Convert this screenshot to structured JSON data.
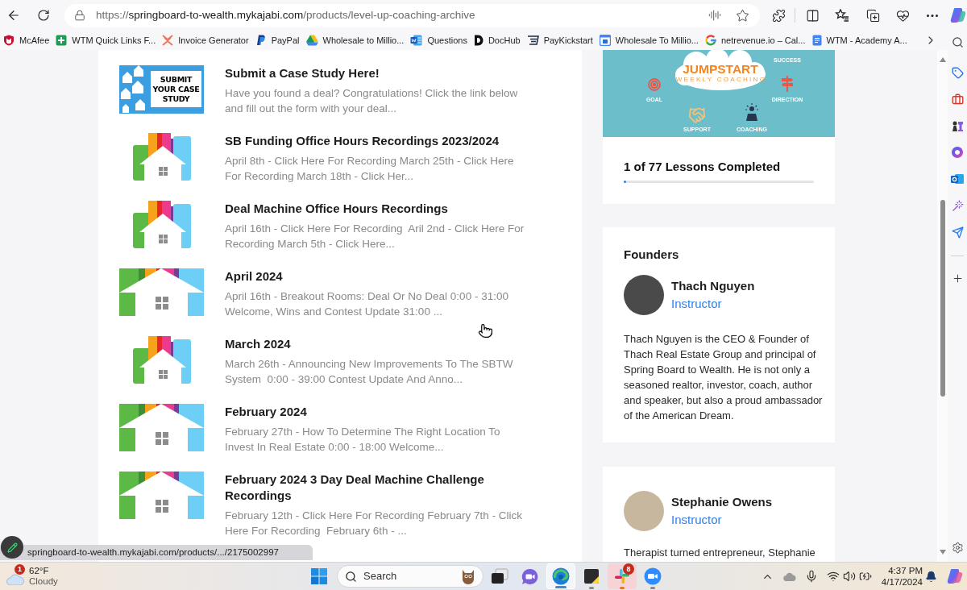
{
  "browser": {
    "url": {
      "scheme": "https://",
      "host": "springboard-to-wealth.mykajabi.com",
      "path": "/products/level-up-coaching-archive"
    }
  },
  "bookmarks": [
    {
      "label": "McAfee",
      "kind": "shield"
    },
    {
      "label": "WTM Quick Links F...",
      "kind": "sheet"
    },
    {
      "label": "Invoice Generator",
      "kind": "chevrons"
    },
    {
      "label": "PayPal",
      "kind": "pmark"
    },
    {
      "label": "Wholesale to Millio...",
      "kind": "triangle"
    },
    {
      "label": "Questions",
      "kind": "word"
    },
    {
      "label": "DocHub",
      "kind": "dmark"
    },
    {
      "label": "PayKickstart",
      "kind": "receipt"
    },
    {
      "label": "Wholesale To Millio...",
      "kind": "calendar"
    },
    {
      "label": "netrevenue.io – Cal...",
      "kind": "gmark"
    },
    {
      "label": "WTM - Academy A...",
      "kind": "doc"
    }
  ],
  "lessons": [
    {
      "kind": "case",
      "thumbnail_text": "SUBMIT YOUR CASE STUDY",
      "title": "Submit a Case Study Here!",
      "description": "Have you found a deal? Congratulations! Click the link below and fill out the form with your deal..."
    },
    {
      "kind": "square",
      "title": "SB Funding Office Hours Recordings 2023/2024",
      "description": "April 8th - Click Here For Recording March 25th - Click Here For Recording March 18th - Click Her..."
    },
    {
      "kind": "square",
      "title": "Deal Machine Office Hours Recordings",
      "description": "April 16th - Click Here For Recording  Aril 2nd - Click Here For Recording March 5th - Click Here..."
    },
    {
      "kind": "wide",
      "title": "April 2024",
      "description": "April 16th - Breakout Rooms: Deal Or No Deal 0:00 - 31:00 Welcome, Wins and Contest Update 31:00 ..."
    },
    {
      "kind": "square",
      "title": "March 2024",
      "description": "March 26th - Announcing New Improvements To The SBTW System  0:00 - 39:00 Contest Update And Anno..."
    },
    {
      "kind": "wide",
      "title": "February 2024",
      "description": "February 27th - How To Determine The Right Location To Invest In Real Estate 0:00 - 18:00 Welcome..."
    },
    {
      "kind": "wide",
      "title": "February 2024 3 Day Deal Machine Challenge Recordings",
      "description": "February 12th - Click Here For Recording February 7th - Click Here For Recording  February 6th - ..."
    }
  ],
  "banner": {
    "title": "JUMPSTART",
    "subtitle": "WEEKLY COACHING",
    "labels": [
      "SUCCESS",
      "GOAL",
      "DIRECTION",
      "SUPPORT",
      "COACHING"
    ]
  },
  "progress": {
    "label": "1 of 77 Lessons Completed",
    "level": 0.013
  },
  "instructor_cards": [
    {
      "heading": "Founders",
      "name": "Thach Nguyen",
      "role": "Instructor",
      "bio": "Thach Nguyen is the CEO & Founder of Thach Real Estate Group and principal of Spring Board to Wealth. He is not only a seasoned realtor, investor, coach, author and speaker, but also a proud ambassador of the American Dream."
    },
    {
      "name": "Stephanie Owens",
      "role": "Instructor",
      "bio": "Therapist turned entrepreneur, Stephanie"
    }
  ],
  "status_url": "springboard-to-wealth.mykajabi.com/products/.../2175002997",
  "taskbar": {
    "weather": {
      "badge": "1",
      "temperature": "62°F",
      "condition": "Cloudy"
    },
    "search": {
      "placeholder": "Search"
    },
    "apps": [
      {
        "kind": "taskview",
        "selected": false,
        "running": false,
        "flashing": false
      },
      {
        "kind": "meet",
        "selected": false,
        "running": false,
        "flashing": false
      },
      {
        "kind": "browser",
        "selected": true,
        "running": true,
        "flashing": false
      },
      {
        "kind": "notes",
        "selected": false,
        "running": true,
        "flashing": false
      },
      {
        "kind": "chat",
        "selected": false,
        "running": true,
        "flashing": true,
        "badge": "8"
      },
      {
        "kind": "video",
        "selected": false,
        "running": true,
        "flashing": false
      }
    ],
    "clock": {
      "time": "4:37 PM",
      "date": "4/17/2024"
    }
  }
}
